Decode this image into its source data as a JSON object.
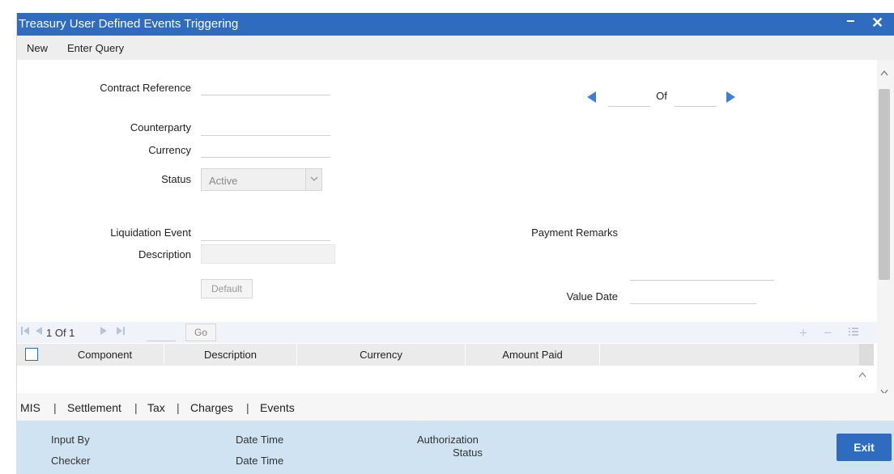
{
  "window": {
    "title": "Treasury User Defined Events Triggering",
    "minimize_label": "−",
    "close_label": "✕"
  },
  "menu": {
    "new_label": "New",
    "enter_query_label": "Enter Query"
  },
  "form": {
    "contract_reference_label": "Contract Reference",
    "contract_reference_value": "",
    "counterparty_label": "Counterparty",
    "counterparty_value": "",
    "currency_label": "Currency",
    "currency_value": "",
    "status_label": "Status",
    "status_value": "Active",
    "liquidation_event_label": "Liquidation Event",
    "liquidation_event_value": "",
    "description_label": "Description",
    "description_value": "",
    "default_button_label": "Default",
    "payment_remarks_label": "Payment Remarks",
    "payment_remarks_value": "",
    "value_date_label": "Value Date",
    "value_date_value": "",
    "record_nav": {
      "current": "",
      "of_label": "Of",
      "total": ""
    }
  },
  "grid": {
    "pager_text": "1 Of 1",
    "go_label": "Go",
    "columns": [
      "Component",
      "Description",
      "Currency",
      "Amount Paid"
    ],
    "rows": []
  },
  "tabs": [
    "MIS",
    "Settlement",
    "Tax",
    "Charges",
    "Events"
  ],
  "tab_separator": "|",
  "footer": {
    "input_by_label": "Input By",
    "checker_label": "Checker",
    "date_time_label": "Date Time",
    "authorization_label": "Authorization",
    "status_label": "Status",
    "exit_label": "Exit"
  },
  "colors": {
    "title_bar": "#2f6cbf",
    "footer": "#cfe3f3",
    "nav_arrow": "#3b82d6"
  }
}
